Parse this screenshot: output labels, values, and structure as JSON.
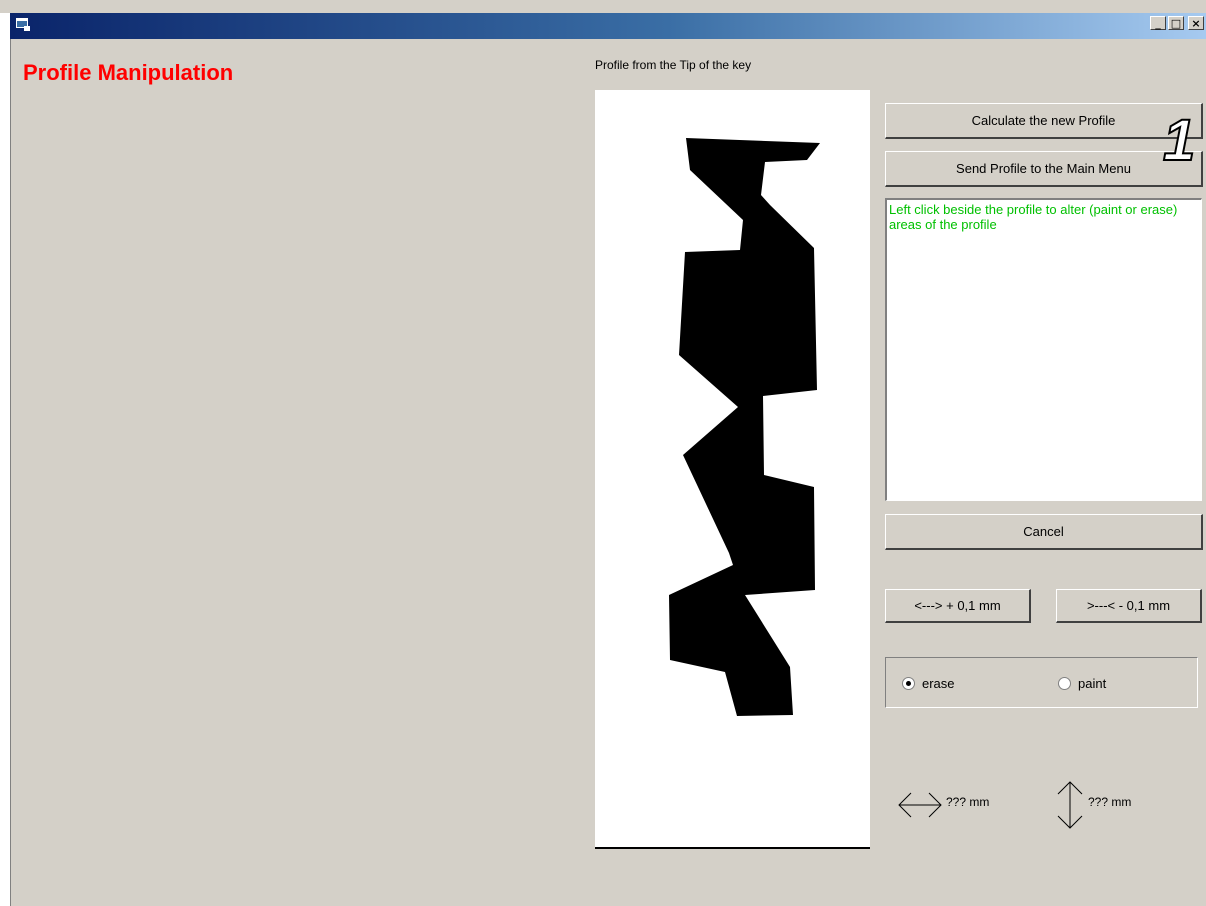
{
  "window": {
    "title": "",
    "controls": {
      "minimize": "_",
      "maximize": "□",
      "close": "×"
    }
  },
  "header": {
    "title": "Profile Manipulation"
  },
  "profile": {
    "label": "Profile from the Tip of the key"
  },
  "buttons": {
    "calculate": "Calculate the new Profile",
    "send": "Send Profile to the Main Menu",
    "cancel": "Cancel",
    "widen": "<---> + 0,1 mm",
    "narrow": ">---< - 0,1 mm"
  },
  "instructions": "Left click beside the profile to alter (paint or erase) areas of the profile",
  "mode": {
    "options": [
      "erase",
      "paint"
    ],
    "selected": "erase"
  },
  "dimensions": {
    "width_value": "??? mm",
    "height_value": "??? mm"
  },
  "annotation": {
    "badge": "1"
  },
  "colors": {
    "title_red": "#ff0000",
    "instruction_green": "#00c000",
    "face": "#d4d0c8"
  },
  "icons": [
    "app-icon",
    "horizontal-arrow-icon",
    "vertical-arrow-icon"
  ]
}
